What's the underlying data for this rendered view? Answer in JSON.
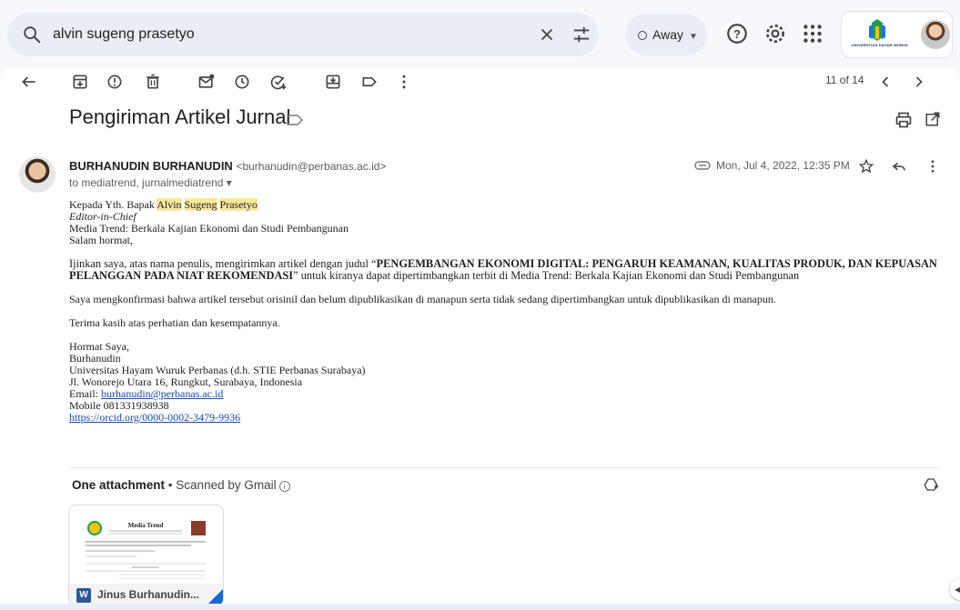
{
  "search": {
    "query": "alvin sugeng prasetyo"
  },
  "presence": {
    "label": "Away"
  },
  "brand": {
    "logo_text": "UNIVERSITAS HAYAM WURUK"
  },
  "toolbar": {
    "counter": "11 of 14"
  },
  "email": {
    "subject": "Pengiriman Artikel Jurnal",
    "sender_name": "BURHANUDIN BURHANUDIN",
    "sender_email": "<burhanudin@perbanas.ac.id>",
    "recipients": "to mediatrend, jurnalmediatrend",
    "date": "Mon, Jul 4, 2022, 12:35 PM",
    "body": {
      "greeting_prefix": "Kepada Yth. Bapak ",
      "greeting_name1": "Alvin",
      "greeting_name2": "Sugeng",
      "greeting_name3": "Prasetyo",
      "role": "Editor-in-Chief",
      "journal": "Media Trend: Berkala Kajian Ekonomi dan Studi Pembangunan",
      "salam": "Salam hormat,",
      "para1_start": "Ijinkan saya, atas nama penulis, mengirimkan artikel dengan judul “",
      "para1_title": "PENGEMBANGAN EKONOMI DIGITAL: PENGARUH KEAMANAN, KUALITAS PRODUK, DAN KEPUASAN PELANGGAN PADA NIAT REKOMENDASI",
      "para1_end": "” untuk kiranya dapat dipertimbangkan terbit di Media Trend: Berkala Kajian Ekonomi dan Studi Pembangunan",
      "para2": "Saya mengkonfirmasi bahwa artikel tersebut orisinil dan belum dipublikasikan di manapun serta tidak sedang dipertimbangkan untuk dipublikasikan di manapun.",
      "para3": "Terima kasih atas perhatian dan kesempatannya.",
      "sig_hormat": "Hormat Saya,",
      "sig_name": "Burhanudin",
      "sig_univ": "Universitas Hayam Wuruk Perbanas (d.h. STIE Perbanas Surabaya)",
      "sig_address": "Jl. Wonorejo Utara 16, Rungkut, Surabaya, Indonesia",
      "sig_email_label": "Email: ",
      "sig_email": "burhanudin@perbanas.ac.id",
      "sig_mobile": "Mobile 081331938938",
      "sig_orcid": "https://orcid.org/0000-0002-3479-9936"
    }
  },
  "attachments": {
    "heading": "One attachment",
    "separator": "•",
    "scanned": "Scanned by Gmail",
    "file_name": "Jinus Burhanudin...",
    "file_type_badge": "W",
    "preview_title": "Media Trend"
  },
  "colors": {
    "highlight": "#fde89a",
    "link": "#1a47b8",
    "word_blue": "#2b579a"
  }
}
